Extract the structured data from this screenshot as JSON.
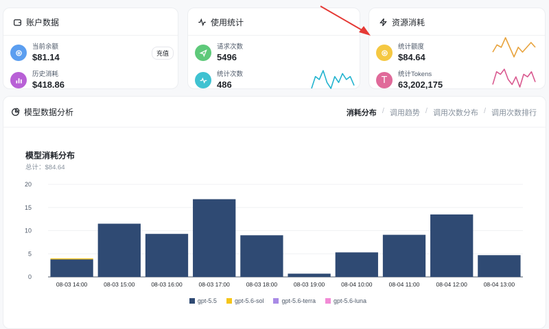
{
  "account": {
    "title": "账户数据",
    "balance_label": "当前余额",
    "balance_value": "$81.14",
    "recharge_label": "充值",
    "history_label": "历史消耗",
    "history_value": "$418.86"
  },
  "usage": {
    "title": "使用统计",
    "requests_label": "请求次数",
    "requests_value": "5496",
    "count_label": "统计次数",
    "count_value": "486"
  },
  "resources": {
    "title": "资源消耗",
    "quota_label": "统计额度",
    "quota_value": "$84.64",
    "tokens_label": "统计Tokens",
    "tokens_value": "63,202,175"
  },
  "analysis": {
    "title": "模型数据分析",
    "tabs": [
      "消耗分布",
      "调用趋势",
      "调用次数分布",
      "调用次数排行"
    ],
    "active_tab": "消耗分布"
  },
  "colors": {
    "blue": "#5b9ef0",
    "purple": "#b860d6",
    "green": "#5ec97a",
    "cyan": "#3fc2d1",
    "yellow": "#f5c842",
    "pink": "#e06a9a",
    "bar": "#2f4a73",
    "spark_cyan": "#22b3cf",
    "spark_orange": "#e8a33d",
    "spark_pink": "#d9588f"
  },
  "icons": {
    "wallet": "wallet-icon",
    "activity": "activity-icon",
    "zap": "zap-icon",
    "pie": "pie-chart-icon"
  },
  "chart_data": {
    "type": "bar",
    "title": "模型消耗分布",
    "subtitle": "总计：$84.64",
    "categories": [
      "08-03 14:00",
      "08-03 15:00",
      "08-03 16:00",
      "08-03 17:00",
      "08-03 18:00",
      "08-03 19:00",
      "08-04 10:00",
      "08-04 11:00",
      "08-04 12:00",
      "08-04 13:00"
    ],
    "series": [
      {
        "name": "gpt-5.5",
        "color": "#2f4a73",
        "values": [
          3.8,
          11.5,
          9.3,
          16.8,
          9.0,
          0.7,
          5.3,
          9.1,
          13.5,
          4.7
        ]
      },
      {
        "name": "gpt-5.6-sol",
        "color": "#f5c518",
        "values": [
          0.2,
          0,
          0,
          0,
          0,
          0,
          0,
          0,
          0,
          0
        ]
      },
      {
        "name": "gpt-5.6-terra",
        "color": "#a98be6",
        "values": [
          0,
          0,
          0,
          0,
          0,
          0,
          0,
          0,
          0,
          0
        ]
      },
      {
        "name": "gpt-5.6-luna",
        "color": "#f28bd6",
        "values": [
          0,
          0,
          0,
          0,
          0,
          0,
          0,
          0,
          0,
          0
        ]
      }
    ],
    "ylim": [
      0,
      20
    ],
    "yticks": [
      0,
      5,
      10,
      15,
      20
    ],
    "grid": true,
    "legend": "bottom",
    "stacked": true
  },
  "sparklines": {
    "count": [
      2,
      6,
      5,
      8,
      4,
      2,
      6,
      4,
      7,
      5,
      6,
      3
    ],
    "quota": [
      3,
      6,
      5,
      9,
      5,
      1,
      5,
      3,
      5,
      7,
      5
    ],
    "tokens": [
      2,
      7,
      6,
      8,
      4,
      2,
      5,
      1,
      6,
      5,
      7,
      3
    ]
  }
}
